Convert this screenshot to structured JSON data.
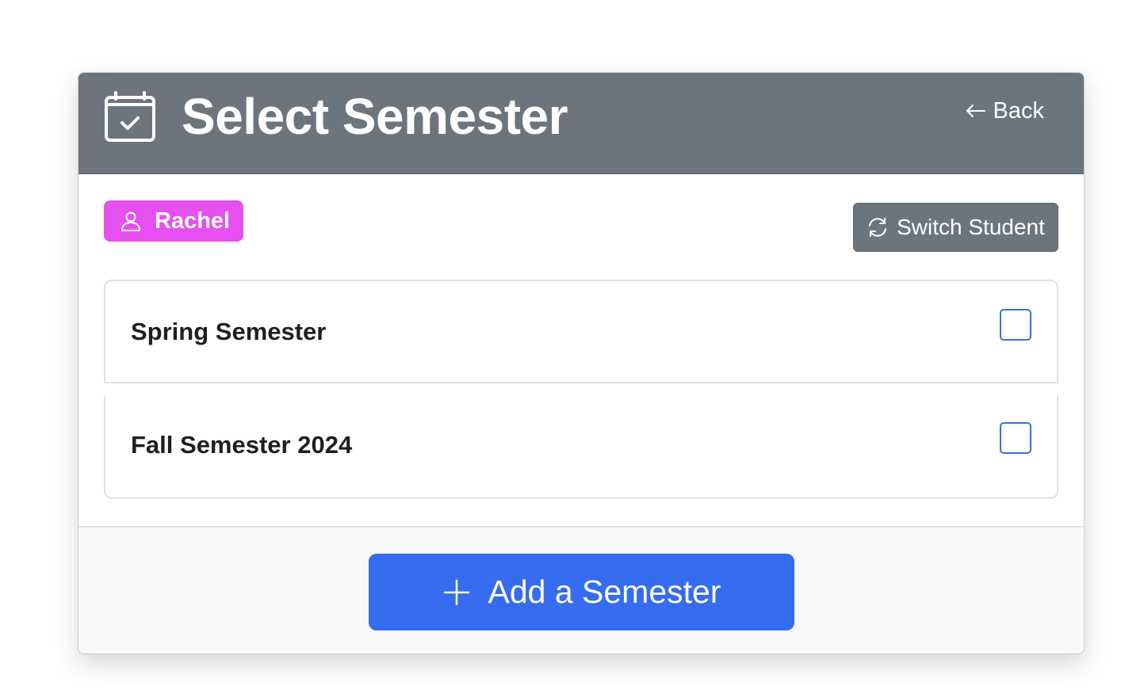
{
  "header": {
    "title": "Select Semester",
    "icon": "calendar-check-icon",
    "back_label": "Back",
    "back_icon": "arrow-left-icon",
    "background_color": "#6c757d"
  },
  "student": {
    "name": "Rachel",
    "icon": "person-icon",
    "badge_color": "#e64ff0"
  },
  "switch_button": {
    "label": "Switch Student",
    "icon": "refresh-icon"
  },
  "semesters": [
    {
      "label": "Spring Semester",
      "checked": false
    },
    {
      "label": "Fall Semester 2024",
      "checked": false
    }
  ],
  "add_button": {
    "label": "Add a Semester",
    "icon": "plus-icon",
    "color": "#356cf0"
  }
}
